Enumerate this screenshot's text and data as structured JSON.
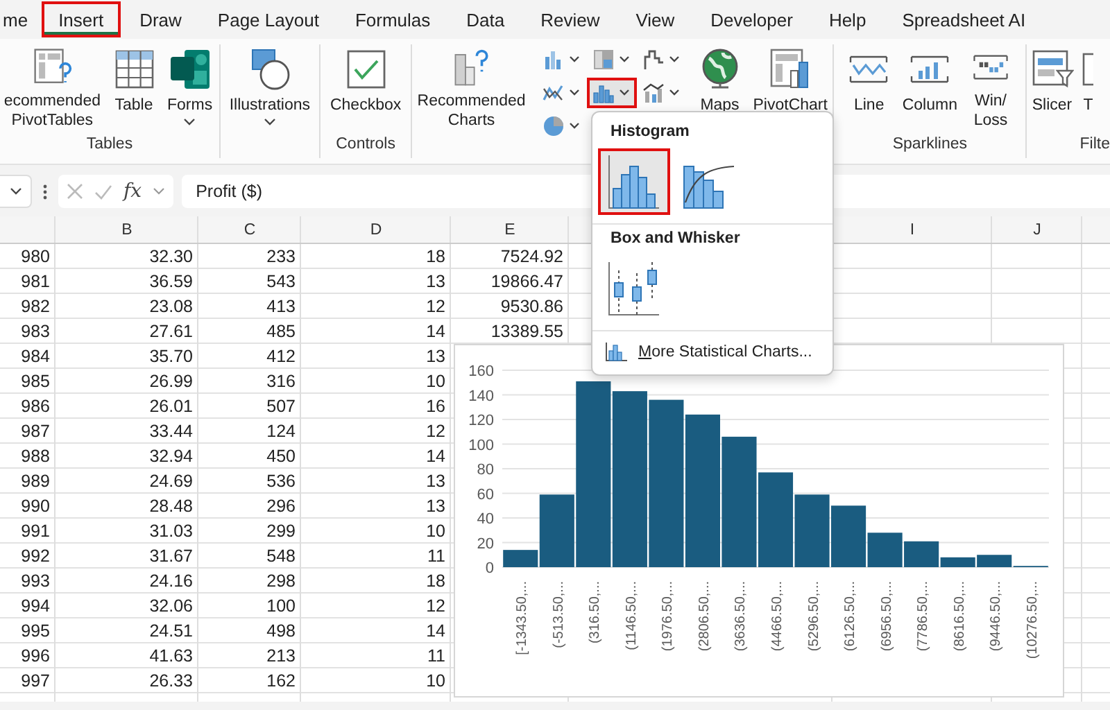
{
  "tabs": [
    {
      "label": "me",
      "selected": false,
      "highlighted": false
    },
    {
      "label": "Insert",
      "selected": true,
      "highlighted": true
    },
    {
      "label": "Draw",
      "selected": false,
      "highlighted": false
    },
    {
      "label": "Page Layout",
      "selected": false,
      "highlighted": false
    },
    {
      "label": "Formulas",
      "selected": false,
      "highlighted": false
    },
    {
      "label": "Data",
      "selected": false,
      "highlighted": false
    },
    {
      "label": "Review",
      "selected": false,
      "highlighted": false
    },
    {
      "label": "View",
      "selected": false,
      "highlighted": false
    },
    {
      "label": "Developer",
      "selected": false,
      "highlighted": false
    },
    {
      "label": "Help",
      "selected": false,
      "highlighted": false
    },
    {
      "label": "Spreadsheet AI",
      "selected": false,
      "highlighted": false
    }
  ],
  "ribbon_groups": [
    {
      "label": "Tables",
      "buttons": [
        {
          "kind": "pivot",
          "lines": [
            "ecommended",
            "PivotTables"
          ],
          "dropdown": false
        },
        {
          "kind": "table",
          "lines": [
            "Table"
          ],
          "dropdown": false
        },
        {
          "kind": "forms",
          "lines": [
            "Forms"
          ],
          "dropdown": true
        }
      ]
    },
    {
      "buttons": [
        {
          "kind": "illustrations",
          "lines": [
            "Illustrations"
          ],
          "dropdown": true
        }
      ]
    },
    {
      "label": "Controls",
      "buttons": [
        {
          "kind": "checkbox",
          "lines": [
            "Checkbox"
          ],
          "dropdown": false
        }
      ]
    },
    {
      "buttons": [
        {
          "kind": "recommended-charts",
          "lines": [
            "Recommended",
            "Charts"
          ],
          "dropdown": false
        },
        {
          "kind": "small-grid",
          "items": [
            {
              "kind": "column",
              "highlighted": false
            },
            {
              "kind": "hierarchy",
              "highlighted": false
            },
            {
              "kind": "waterfall",
              "highlighted": false
            },
            {
              "kind": "line",
              "highlighted": false
            },
            {
              "kind": "statistic",
              "highlighted": true
            },
            {
              "kind": "combo",
              "highlighted": false
            },
            {
              "kind": "pie",
              "highlighted": false
            }
          ]
        },
        {
          "kind": "maps",
          "lines": [
            "Maps"
          ]
        },
        {
          "kind": "pivotchart",
          "lines": [
            "PivotChart"
          ]
        }
      ]
    },
    {
      "label": "Sparklines",
      "buttons": [
        {
          "kind": "spark-line",
          "lines": [
            "Line"
          ],
          "dropdown": false
        },
        {
          "kind": "spark-column",
          "lines": [
            "Column"
          ],
          "dropdown": false
        },
        {
          "kind": "spark-winloss",
          "lines": [
            "Win/",
            "Loss"
          ],
          "dropdown": false
        }
      ]
    },
    {
      "label": "Filte",
      "buttons": [
        {
          "kind": "slicer",
          "lines": [
            "Slicer"
          ],
          "dropdown": false
        },
        {
          "kind": "timeline",
          "lines": [
            "T"
          ],
          "dropdown": false
        }
      ]
    }
  ],
  "formula_bar": {
    "function_label": "fx",
    "value": "Profit ($)"
  },
  "columns": [
    {
      "label": "B"
    },
    {
      "label": "C"
    },
    {
      "label": "D"
    },
    {
      "label": "E"
    },
    {
      "label": "I"
    },
    {
      "label": "J"
    }
  ],
  "rows": [
    {
      "cells": [
        "980",
        "32.30",
        "233",
        "18",
        "7524.92"
      ]
    },
    {
      "cells": [
        "981",
        "36.59",
        "543",
        "13",
        "19866.47"
      ]
    },
    {
      "cells": [
        "982",
        "23.08",
        "413",
        "12",
        "9530.86"
      ]
    },
    {
      "cells": [
        "983",
        "27.61",
        "485",
        "14",
        "13389.55"
      ]
    },
    {
      "cells": [
        "984",
        "35.70",
        "412",
        "13"
      ]
    },
    {
      "cells": [
        "985",
        "26.99",
        "316",
        "10"
      ]
    },
    {
      "cells": [
        "986",
        "26.01",
        "507",
        "16"
      ]
    },
    {
      "cells": [
        "987",
        "33.44",
        "124",
        "12"
      ]
    },
    {
      "cells": [
        "988",
        "32.94",
        "450",
        "14"
      ]
    },
    {
      "cells": [
        "989",
        "24.69",
        "536",
        "13"
      ]
    },
    {
      "cells": [
        "990",
        "28.48",
        "296",
        "13"
      ]
    },
    {
      "cells": [
        "991",
        "31.03",
        "299",
        "10"
      ]
    },
    {
      "cells": [
        "992",
        "31.67",
        "548",
        "11"
      ]
    },
    {
      "cells": [
        "993",
        "24.16",
        "298",
        "18"
      ]
    },
    {
      "cells": [
        "994",
        "32.06",
        "100",
        "12"
      ]
    },
    {
      "cells": [
        "995",
        "24.51",
        "498",
        "14"
      ]
    },
    {
      "cells": [
        "996",
        "41.63",
        "213",
        "11"
      ]
    },
    {
      "cells": [
        "997",
        "26.33",
        "162",
        "10"
      ]
    }
  ],
  "chart": {
    "chart_data": {
      "type": "bar",
      "categories": [
        "[-1343.50,...",
        "(-513.50,...",
        "(316.50,...",
        "(1146.50,...",
        "(1976.50,...",
        "(2806.50,...",
        "(3636.50,...",
        "(4466.50,...",
        "(5296.50,...",
        "(6126.50,...",
        "(6956.50,...",
        "(7786.50,...",
        "(8616.50,...",
        "(9446.50,...",
        "(10276.50,..."
      ],
      "values": [
        14,
        59,
        151,
        143,
        136,
        124,
        106,
        77,
        59,
        50,
        28,
        21,
        8,
        10,
        1
      ],
      "ylim": [
        0,
        160
      ],
      "grid": true,
      "yticks": [
        0,
        20,
        40,
        60,
        80,
        100,
        120,
        140,
        160
      ]
    }
  },
  "dropdown": {
    "sections": [
      {
        "title": "Histogram",
        "options": [
          {
            "kind": "histogram",
            "highlighted": true
          },
          {
            "kind": "pareto",
            "highlighted": false
          }
        ]
      },
      {
        "title": "Box and Whisker",
        "options": [
          {
            "kind": "box-whisker",
            "highlighted": false
          }
        ]
      }
    ],
    "more_link": "More Statistical Charts..."
  }
}
